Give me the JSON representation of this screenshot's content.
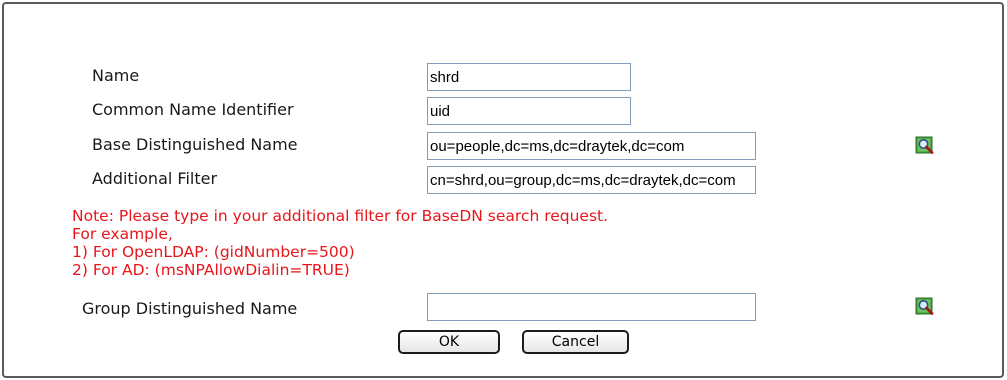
{
  "form": {
    "name": {
      "label": "Name",
      "value": "shrd"
    },
    "common_name": {
      "label": "Common Name Identifier",
      "value": "uid"
    },
    "base_dn": {
      "label": "Base Distinguished Name",
      "value": "ou=people,dc=ms,dc=draytek,dc=com"
    },
    "additional_filter": {
      "label": "Additional Filter",
      "value": "cn=shrd,ou=group,dc=ms,dc=draytek,dc=com"
    },
    "group_dn": {
      "label": "Group Distinguished Name",
      "value": ""
    }
  },
  "note": {
    "line1": "Note: Please type in your additional filter for BaseDN search request.",
    "line2": "For example,",
    "line3": "1) For OpenLDAP: (gidNumber=500)",
    "line4": "2) For AD: (msNPAllowDialin=TRUE)",
    "color": "#e8161b"
  },
  "buttons": {
    "ok": "OK",
    "cancel": "Cancel"
  },
  "icons": {
    "base_dn_search": "search-icon",
    "group_dn_search": "search-icon"
  }
}
